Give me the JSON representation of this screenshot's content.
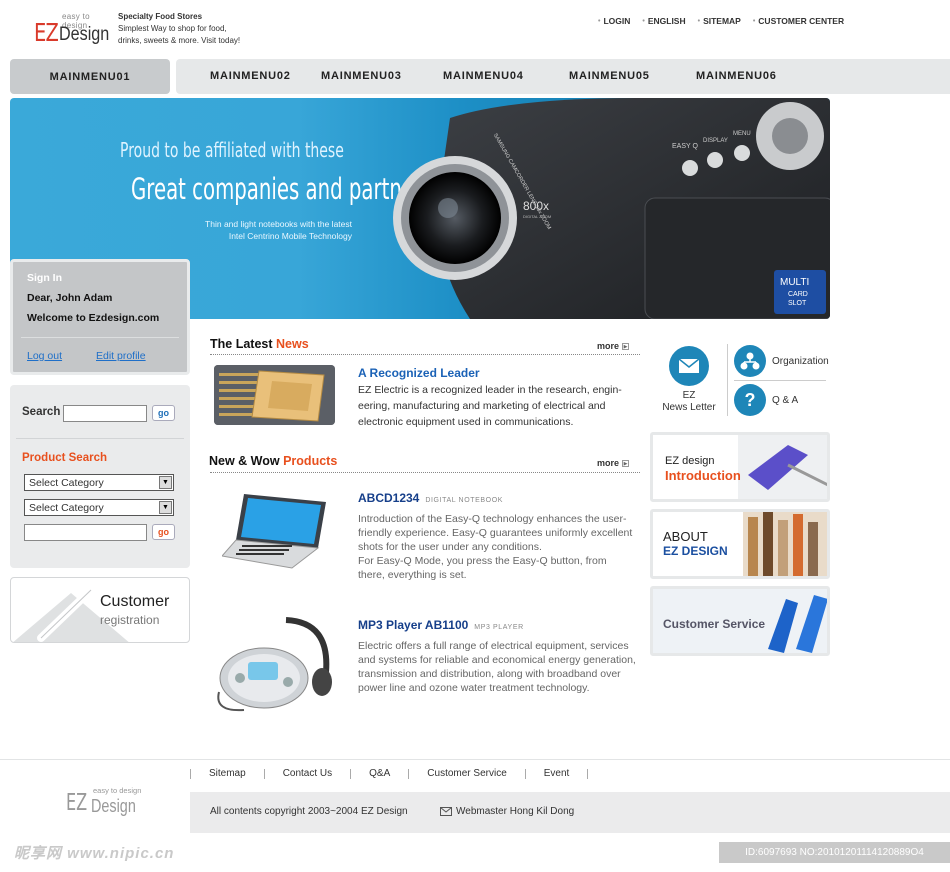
{
  "header": {
    "logo_small": "easy to design",
    "logo_ez": "EZ",
    "logo_design": "Design",
    "slogan_line1": "Specialty Food Stores",
    "slogan_line2": "Simplest Way to shop for food,",
    "slogan_line3": "drinks, sweets & more. Visit today!",
    "top_links": [
      "LOGIN",
      "ENGLISH",
      "SITEMAP",
      "CUSTOMER CENTER"
    ]
  },
  "menu": [
    "MAINMENU01",
    "MAINMENU02",
    "MAINMENU03",
    "MAINMENU04",
    "MAINMENU05",
    "MAINMENU06"
  ],
  "banner": {
    "line1": "Proud to be affiliated with these",
    "line2": "Great companies and partners.",
    "line3": "Thin and light notebooks with the latest",
    "line4": "Intel Centrino Mobile Technology",
    "cam_zoom": "800x",
    "cam_zoom_sub": "DIGITAL ZOOM",
    "cam_lens": "SAMSUNG CAMCORDER LENS 10x ZOOM",
    "cam_buttons": [
      "EASY Q",
      "DISPLAY",
      "MENU"
    ],
    "cam_multi": "MULTI",
    "cam_card": "CARD",
    "cam_slot": "SLOT"
  },
  "signin": {
    "title": "Sign In",
    "greeting": "Dear, John Adam",
    "welcome": "Welcome to Ezdesign.com",
    "logout": "Log out",
    "edit_profile": "Edit profile"
  },
  "search": {
    "label": "Search",
    "go": "go",
    "product_search": "Product Search",
    "category1": "Select Category",
    "category2": "Select Category",
    "go2": "go"
  },
  "customer_reg": {
    "title": "Customer",
    "subtitle": "registration"
  },
  "news": {
    "title_a": "The Latest",
    "title_b": "News",
    "more": "more",
    "headline": "A  Recognized Leader",
    "body": "EZ Electric is a recognized leader in the research, engin-eering, manufacturing and marketing of electrical and electronic equipment used in communications."
  },
  "products": {
    "title_a": "New & Wow",
    "title_b": "Products",
    "more": "more",
    "items": [
      {
        "name": "ABCD1234",
        "tag": "DIGITAL NOTEBOOK",
        "body1": "Introduction of the Easy-Q technology enhances the user-friendly experience. Easy-Q guarantees uniformly excellent shots for the user under any conditions.",
        "body2": "For Easy-Q Mode, you press the Easy-Q button, from there, everything is set."
      },
      {
        "name": "MP3 Player AB1100",
        "tag": "MP3 PLAYER",
        "body1": "Electric offers a full range of electrical equipment, services and systems for reliable and economical energy generation, transmission and distribution, along with broadband over power line and ozone water treatment technology.",
        "body2": ""
      }
    ]
  },
  "right": {
    "newsletter_1": "EZ",
    "newsletter_2": "News Letter",
    "organization": "Organization",
    "qa": "Q & A",
    "box1_a": "EZ design",
    "box1_b": "Introduction",
    "box2_a": "ABOUT",
    "box2_b": "EZ DESIGN",
    "box3": "Customer Service"
  },
  "footer": {
    "links": [
      "Sitemap",
      "Contact Us",
      "Q&A",
      "Customer Service",
      "Event"
    ],
    "copyright": "All contents copyright 2003~2004 EZ Design",
    "webmaster": "Webmaster Hong Kil Dong",
    "logo_small": "easy to design",
    "logo_ez": "EZ",
    "logo_design": "Design"
  },
  "watermark": {
    "left": "昵享网 www.nipic.cn",
    "right": "ID:6097693 NO:20101201114120889O4"
  },
  "colors": {
    "accent_orange": "#e8501e",
    "link_blue": "#1f6fc8",
    "title_blue": "#163f8a",
    "banner_blue": "#38a6d8"
  }
}
